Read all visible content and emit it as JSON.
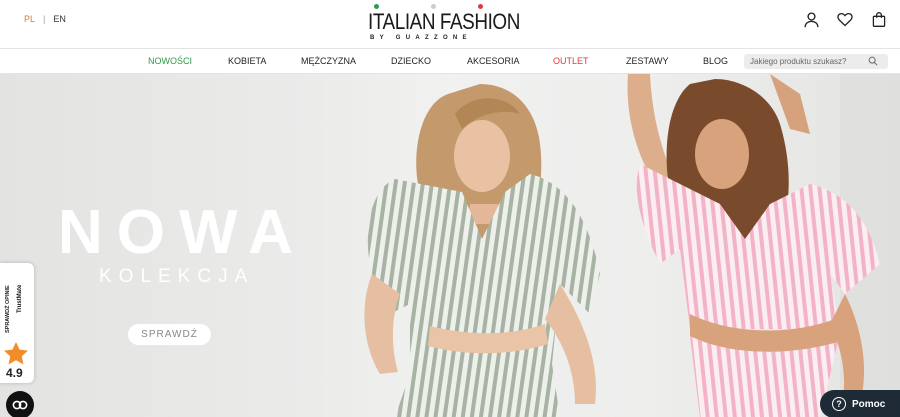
{
  "header": {
    "languages": {
      "active": "PL",
      "other": "EN"
    },
    "logo": {
      "title": "ITALIAN FASHION",
      "subtitle": "BY GUAZZONE",
      "dot_colors": [
        "#2f9a4a",
        "#cccccc",
        "#e03a3a"
      ]
    },
    "icons": [
      "user-icon",
      "heart-icon",
      "bag-icon"
    ]
  },
  "nav": {
    "items": [
      {
        "label": "NOWOŚCI",
        "color": "#2f9a4a"
      },
      {
        "label": "KOBIETA"
      },
      {
        "label": "MĘŻCZYZNA"
      },
      {
        "label": "DZIECKO"
      },
      {
        "label": "AKCESORIA"
      },
      {
        "label": "OUTLET",
        "color": "#e03a3a"
      },
      {
        "label": "ZESTAWY"
      },
      {
        "label": "BLOG"
      }
    ],
    "search": {
      "placeholder": "Jakiego produktu szukasz?"
    }
  },
  "hero": {
    "headline": "NOWA",
    "subline": "KOLEKCJA",
    "cta": "SPRAWDŹ"
  },
  "trustmate": {
    "label": "SPRAWDŹ OPINIE",
    "brand": "TrustMate",
    "rating": "4.9",
    "star_color": "#f28c28"
  },
  "help_widget": {
    "label": "Pomoc",
    "icon": "question-icon"
  },
  "accessibility_widget": {
    "icon": "accessibility-icon"
  }
}
